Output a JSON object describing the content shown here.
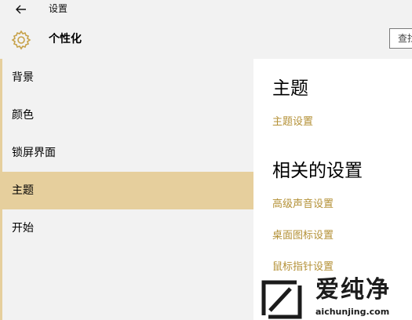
{
  "window": {
    "title": "设置"
  },
  "header": {
    "title": "个性化",
    "search_text": "查找"
  },
  "sidebar": {
    "items": [
      {
        "label": "背景"
      },
      {
        "label": "颜色"
      },
      {
        "label": "锁屏界面"
      },
      {
        "label": "主题",
        "selected": true
      },
      {
        "label": "开始"
      }
    ]
  },
  "main": {
    "theme_heading": "主题",
    "theme_settings_link": "主题设置",
    "related_heading": "相关的设置",
    "related_links": [
      "高级声音设置",
      "桌面图标设置",
      "鼠标指针设置"
    ]
  },
  "watermark": {
    "title": "爱纯净",
    "url": "aichunjing.com"
  },
  "colors": {
    "accent": "#e6cf9d",
    "link": "#b49137",
    "sidebar_bg": "#f2f2f2"
  },
  "icons": {
    "back": "back-arrow-icon",
    "settings": "gear-icon"
  }
}
